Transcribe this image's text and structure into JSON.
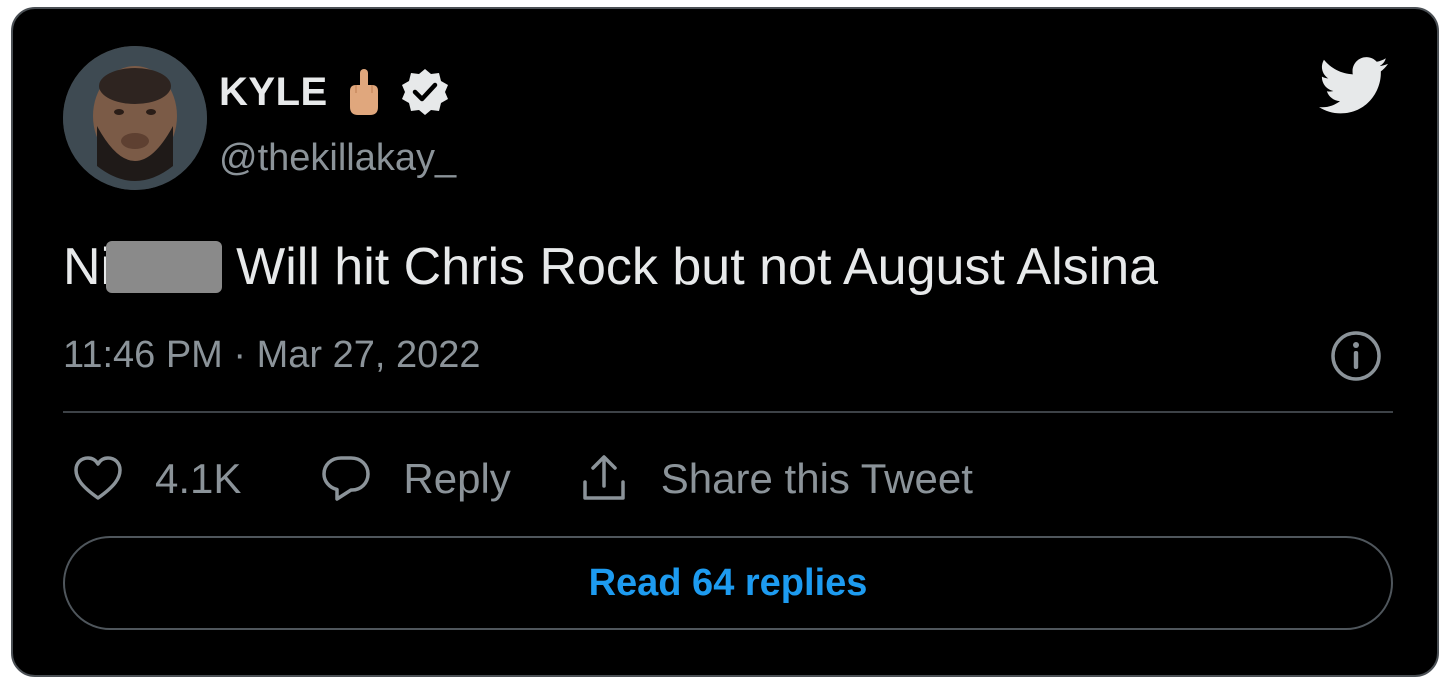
{
  "author": {
    "display_name": "KYLE",
    "handle": "@thekillakay_",
    "emoji_icon": "middle-finger-emoji",
    "verified_icon": "verified-badge-icon"
  },
  "tweet": {
    "text_prefix": "Ni",
    "text_main": "Will hit Chris Rock but not August Alsina",
    "timestamp": "11:46 PM · Mar 27, 2022"
  },
  "actions": {
    "like_count": "4.1K",
    "reply_label": "Reply",
    "share_label": "Share this Tweet"
  },
  "read_replies_label": "Read 64 replies",
  "colors": {
    "background": "#000000",
    "text_primary": "#e7e9ea",
    "text_secondary": "#8b9399",
    "accent": "#1d9bf0",
    "border": "#4a4f54"
  }
}
